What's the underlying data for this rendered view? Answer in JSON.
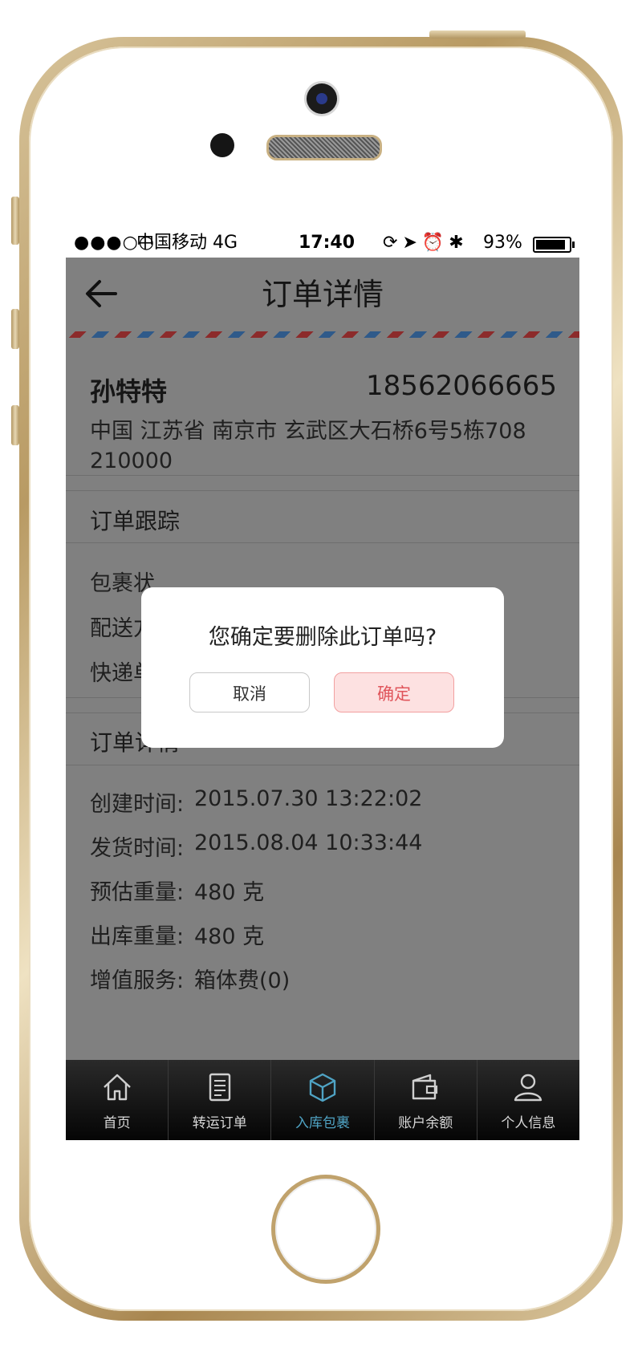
{
  "statusbar": {
    "signal": "●●●○○",
    "carrier": "中国移动 4G",
    "time": "17:40",
    "battery_pct": "93%"
  },
  "navbar": {
    "title": "订单详情"
  },
  "address": {
    "name": "孙特特",
    "phone": "18562066665",
    "line": "中国 江苏省 南京市 玄武区大石桥6号5栋708",
    "zip": "210000"
  },
  "tracking": {
    "title": "订单跟踪",
    "rows": [
      "包裹状",
      "配送方",
      "快递单"
    ]
  },
  "details": {
    "title": "订单详情",
    "rows": [
      {
        "label": "创建时间:",
        "value": "2015.07.30 13:22:02"
      },
      {
        "label": "发货时间:",
        "value": "2015.08.04 10:33:44"
      },
      {
        "label": "预估重量:",
        "value": "480 克"
      },
      {
        "label": "出库重量:",
        "value": "480 克"
      },
      {
        "label": "增值服务:",
        "value": "箱体费(0)"
      }
    ]
  },
  "tabbar": {
    "items": [
      {
        "label": "首页",
        "icon": "home-icon"
      },
      {
        "label": "转运订单",
        "icon": "document-icon"
      },
      {
        "label": "入库包裹",
        "icon": "package-icon",
        "active": true
      },
      {
        "label": "账户余额",
        "icon": "wallet-icon"
      },
      {
        "label": "个人信息",
        "icon": "user-icon"
      }
    ],
    "active_color": "#4fa3c4"
  },
  "dialog": {
    "message": "您确定要删除此订单吗?",
    "cancel_label": "取消",
    "confirm_label": "确定"
  },
  "colors": {
    "overlay": "#808080",
    "confirm_bg": "#fde1e1",
    "confirm_text": "#e0555b"
  }
}
